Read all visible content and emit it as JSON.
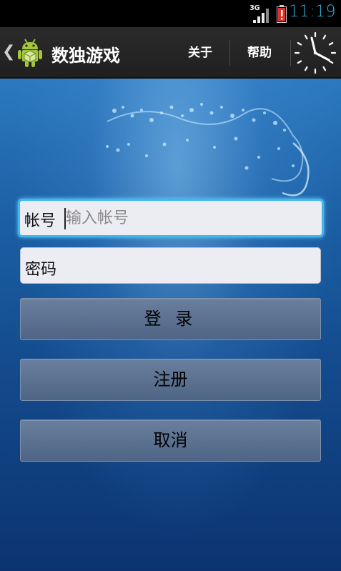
{
  "status_bar": {
    "network": "3G",
    "time": "11:19",
    "icons": [
      "signal-icon",
      "battery-alert-icon"
    ]
  },
  "action_bar": {
    "back_icon": "chevron-left-icon",
    "app_icon": "android-icon",
    "title": "数独游戏",
    "about_label": "关于",
    "help_label": "帮助",
    "clock_icon": "analog-clock-icon"
  },
  "form": {
    "account_label": "帐号",
    "account_placeholder": "输入帐号",
    "account_value": "",
    "password_label": "密码",
    "password_value": "",
    "login_label": "登 录",
    "register_label": "注册",
    "cancel_label": "取消"
  },
  "colors": {
    "status_time": "#33b5e5",
    "focus_border": "#3fb7ef",
    "button_fill": "#5a7090",
    "background": "#134a8c"
  }
}
